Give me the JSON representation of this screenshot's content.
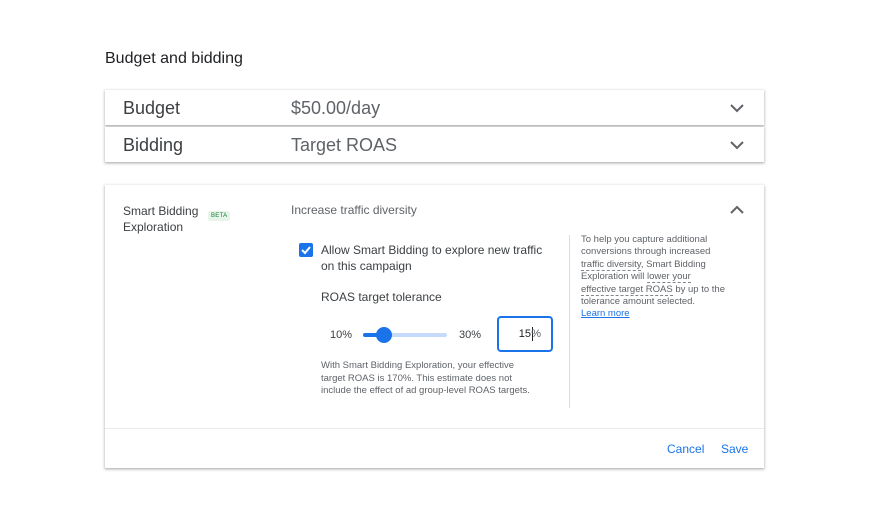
{
  "section_title": "Budget and bidding",
  "budget": {
    "label": "Budget",
    "value": "$50.00/day",
    "icon": "chevron-down-icon"
  },
  "bidding": {
    "label": "Bidding",
    "value": "Target ROAS",
    "icon": "chevron-down-icon"
  },
  "exploration": {
    "label": "Smart Bidding Exploration",
    "badge": "BETA",
    "value": "Increase traffic diversity",
    "icon": "chevron-up-icon",
    "allow_checked": true,
    "allow_label": "Allow Smart Bidding to explore new traffic on this campaign",
    "tolerance_label": "ROAS target tolerance",
    "range_min": "10%",
    "range_max": "30%",
    "tolerance_value": "15",
    "tolerance_slider_fraction": 0.25,
    "tolerance_unit": "%",
    "estimate_part1": "With Smart Bidding Exploration, your effective target ROAS is ",
    "estimate_value": "170%",
    "estimate_part2": ". This estimate does not include the effect of ad group-level ROAS targets.",
    "help_part1": "To help you capture additional conversions through increased ",
    "help_term1": "traffic diversity",
    "help_part2": ", Smart Bidding Exploration will ",
    "help_term2": "lower your effective target ROAS",
    "help_part3": " by up to the tolerance amount selected.",
    "learn_more": "Learn more",
    "cancel_label": "Cancel",
    "save_label": "Save"
  },
  "colors": {
    "accent": "#1a73e8",
    "beta_text": "#188038",
    "beta_bg": "#e6f4ea"
  }
}
